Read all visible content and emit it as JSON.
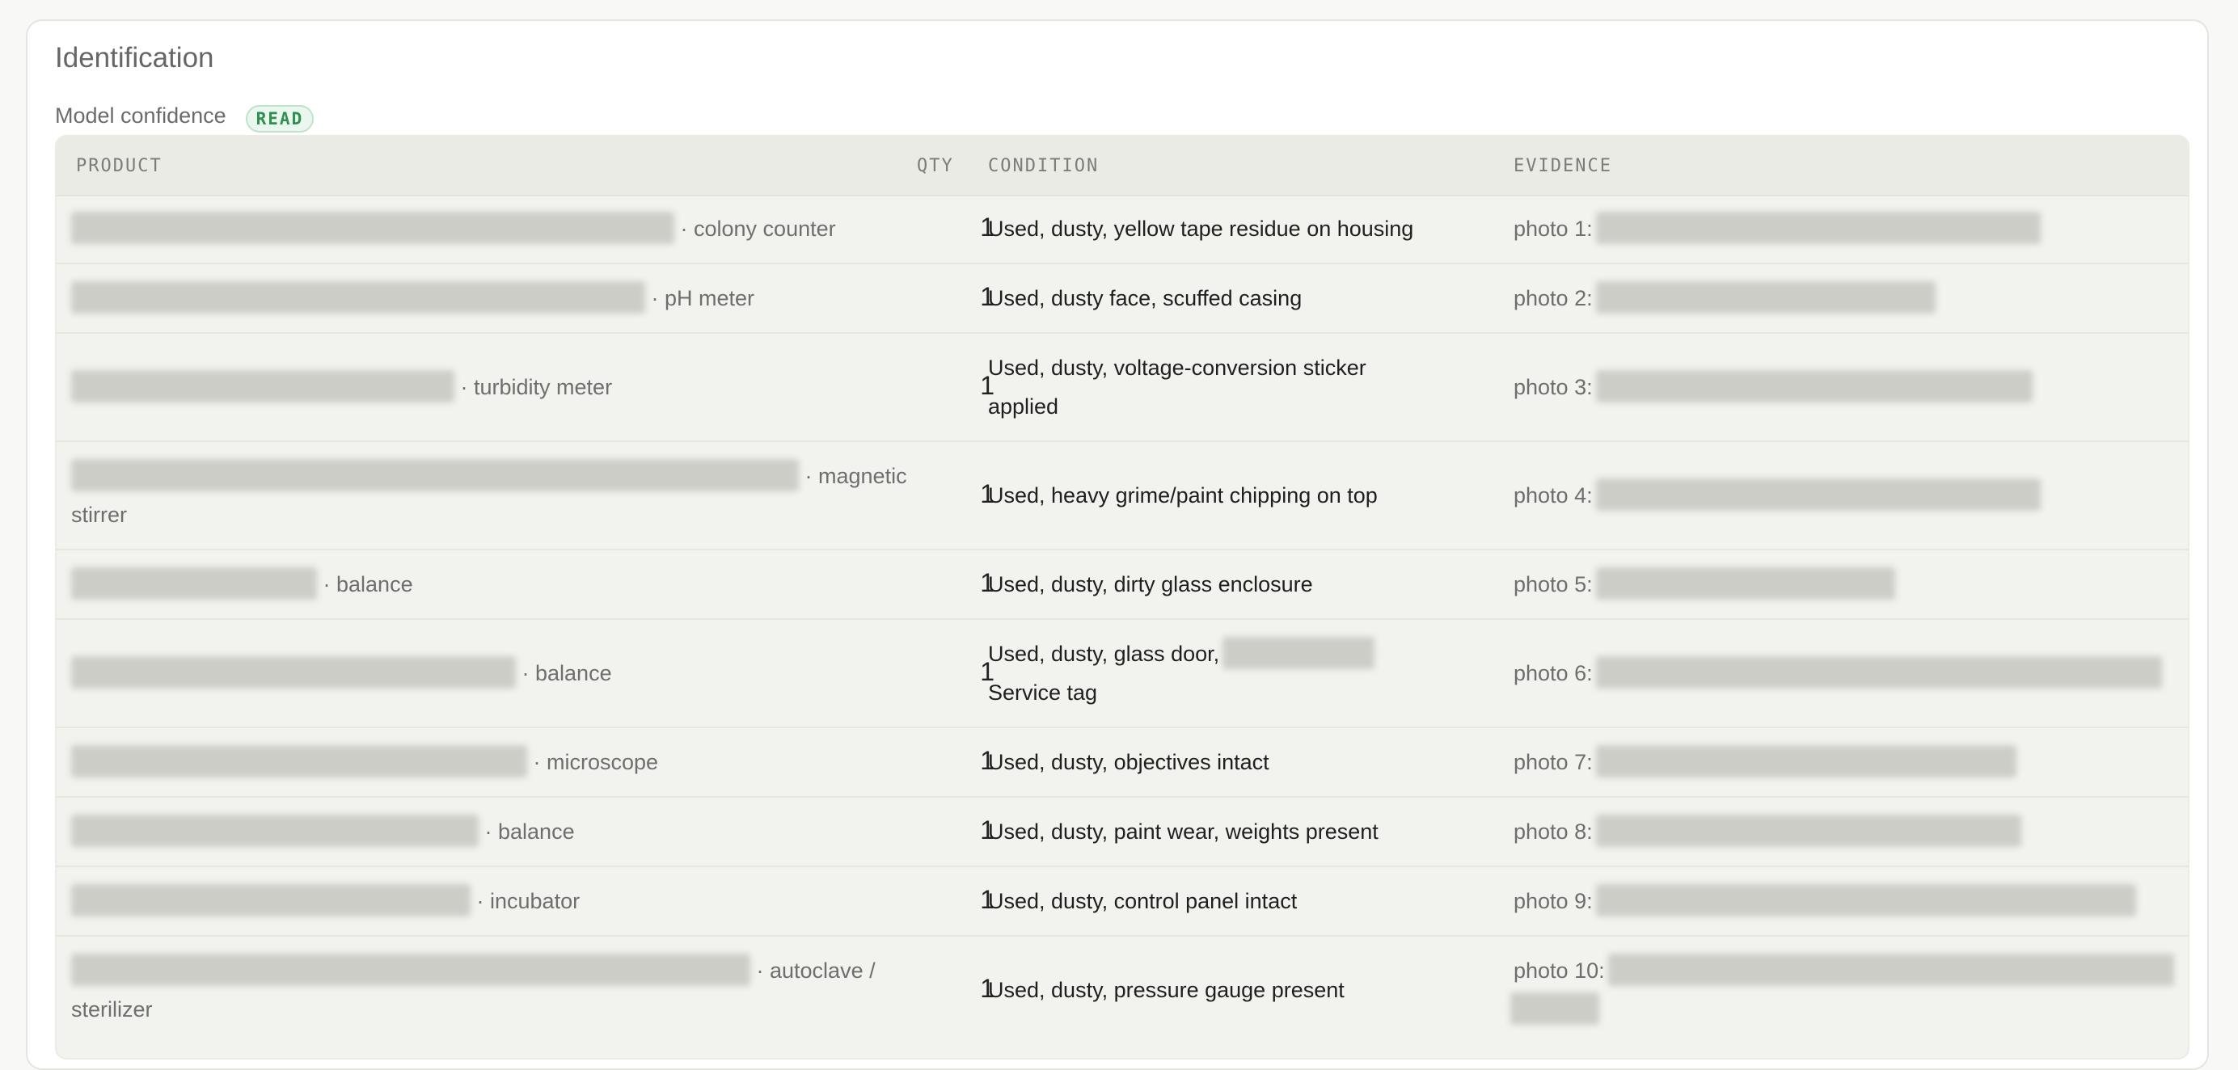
{
  "section": {
    "title": "Identification",
    "confidence_label": "Model confidence",
    "confidence_badge": "READ"
  },
  "table": {
    "headers": {
      "product": "PRODUCT",
      "qty": "QTY",
      "condition": "CONDITION",
      "evidence": "EVIDENCE"
    },
    "rows": [
      {
        "type": "· colony counter",
        "qty": "1",
        "condition": "Used, dusty, yellow tape residue on housing",
        "evidence": "photo 1:"
      },
      {
        "type": "· pH meter",
        "qty": "1",
        "condition": "Used, dusty face, scuffed casing",
        "evidence": "photo 2:"
      },
      {
        "type": "· turbidity meter",
        "qty": "1",
        "condition": "Used, dusty, voltage-conversion sticker applied",
        "evidence": "photo 3:"
      },
      {
        "type": "· magnetic stirrer",
        "qty": "1",
        "condition": "Used, heavy grime/paint chipping on top",
        "evidence": "photo 4:"
      },
      {
        "type": "· balance",
        "qty": "1",
        "condition": "Used, dusty, dirty glass enclosure",
        "evidence": "photo 5:"
      },
      {
        "type": "· balance",
        "qty": "1",
        "condition_pre": "Used, dusty, glass door,",
        "condition_post": "Service tag",
        "evidence": "photo 6:"
      },
      {
        "type": "· microscope",
        "qty": "1",
        "condition": "Used, dusty, objectives intact",
        "evidence": "photo 7:"
      },
      {
        "type": "· balance",
        "qty": "1",
        "condition": "Used, dusty, paint wear, weights present",
        "evidence": "photo 8:"
      },
      {
        "type": "· incubator",
        "qty": "1",
        "condition": "Used, dusty, control panel intact",
        "evidence": "photo 9:"
      },
      {
        "type": "· autoclave / sterilizer",
        "qty": "1",
        "condition": "Used, dusty, pressure gauge present",
        "evidence": "photo 10:"
      }
    ]
  }
}
